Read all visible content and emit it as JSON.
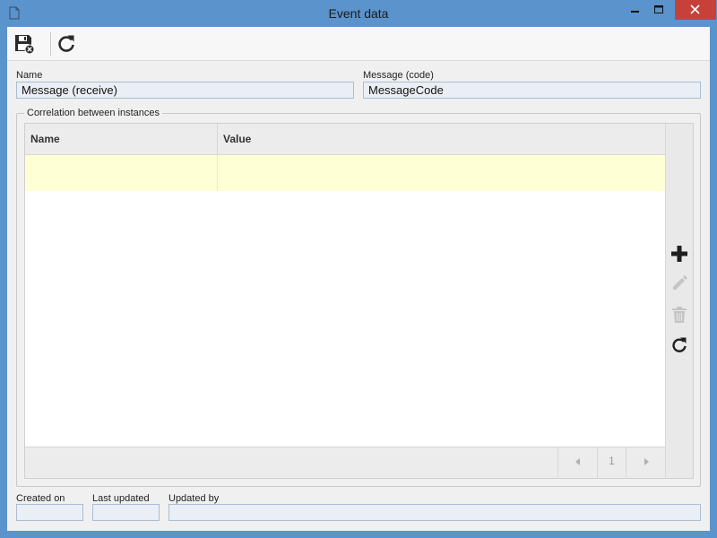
{
  "window": {
    "title": "Event data"
  },
  "form": {
    "name_label": "Name",
    "name_value": "Message (receive)",
    "code_label": "Message (code)",
    "code_value": "MessageCode"
  },
  "correlation": {
    "legend": "Correlation between instances",
    "columns": [
      "Name",
      "Value"
    ],
    "rows": [
      {
        "name": "",
        "value": ""
      }
    ],
    "pager": {
      "page": "1",
      "prev_icon": "triangle-left-icon",
      "next_icon": "triangle-right-icon"
    },
    "actions": [
      {
        "name": "add",
        "icon": "plus-icon",
        "enabled": true
      },
      {
        "name": "edit",
        "icon": "pencil-icon",
        "enabled": false
      },
      {
        "name": "delete",
        "icon": "trash-icon",
        "enabled": false
      },
      {
        "name": "refresh",
        "icon": "refresh-icon",
        "enabled": true
      }
    ]
  },
  "audit": {
    "created_label": "Created on",
    "created_value": "",
    "updated_label": "Last updated",
    "updated_value": "",
    "updated_by_label": "Updated by",
    "updated_by_value": ""
  },
  "toolbar": {
    "save_icon": "save-and-close-icon",
    "refresh_icon": "refresh-icon"
  },
  "colors": {
    "title_bar": "#5b93cc",
    "close_button": "#c7413a",
    "selected_row": "#ffffd6",
    "field_bg": "#eaeff5",
    "field_border": "#a9bdd3"
  }
}
